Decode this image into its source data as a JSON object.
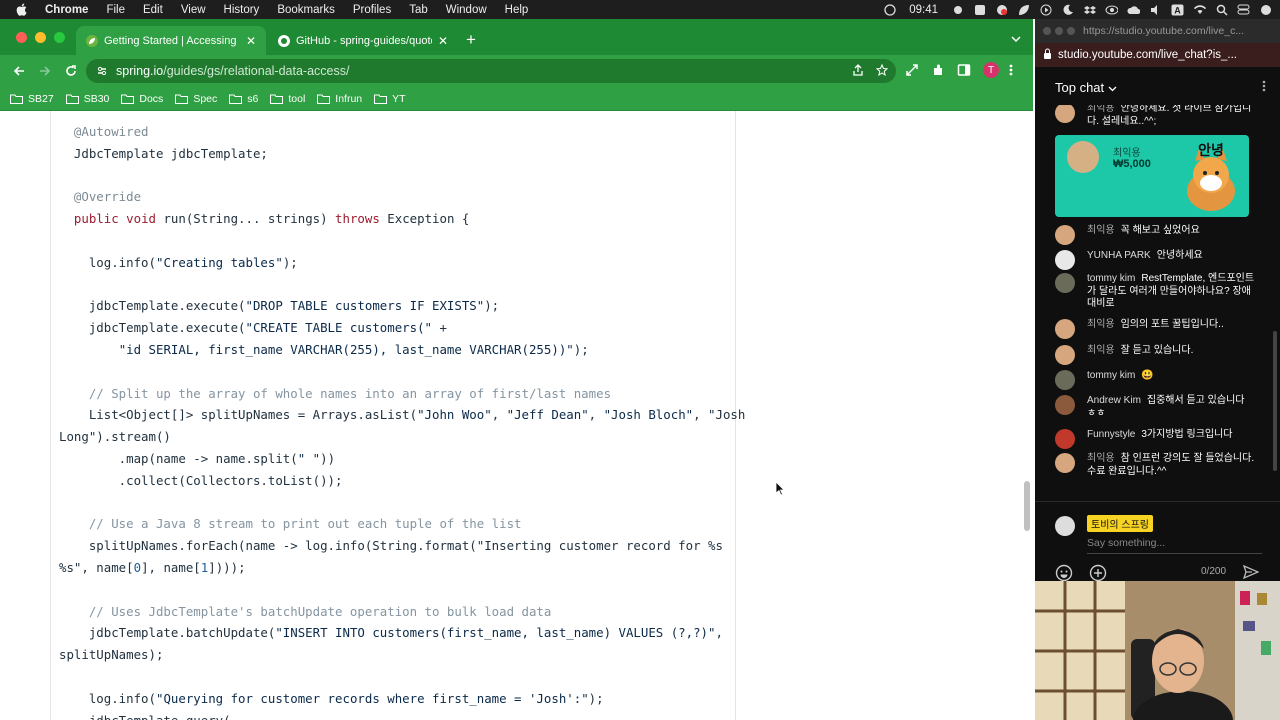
{
  "menubar": {
    "app": "Chrome",
    "items": [
      "File",
      "Edit",
      "View",
      "History",
      "Bookmarks",
      "Profiles",
      "Tab",
      "Window",
      "Help"
    ],
    "time": "09:41"
  },
  "browser": {
    "tabs": [
      {
        "title": "Getting Started | Accessing Re"
      },
      {
        "title": "GitHub - spring-guides/quoter"
      }
    ],
    "url_host": "spring.io",
    "url_path": "/guides/gs/relational-data-access/",
    "profile_initial": "T",
    "bookmarks": [
      "SB27",
      "SB30",
      "Docs",
      "Spec",
      "s6",
      "tool",
      "Infrun",
      "YT"
    ]
  },
  "code": [
    {
      "t": "ann",
      "s": "  @Autowired"
    },
    {
      "t": "plain",
      "s": "  JdbcTemplate jdbcTemplate;"
    },
    {
      "t": "plain",
      "s": ""
    },
    {
      "t": "ann",
      "s": "  @Override"
    },
    {
      "t": "mixed",
      "s": "  public void run(String... strings) throws Exception {"
    },
    {
      "t": "plain",
      "s": ""
    },
    {
      "t": "plain",
      "s": "    log.info(\"Creating tables\");"
    },
    {
      "t": "plain",
      "s": ""
    },
    {
      "t": "plain",
      "s": "    jdbcTemplate.execute(\"DROP TABLE customers IF EXISTS\");"
    },
    {
      "t": "plain",
      "s": "    jdbcTemplate.execute(\"CREATE TABLE customers(\" +"
    },
    {
      "t": "plain",
      "s": "        \"id SERIAL, first_name VARCHAR(255), last_name VARCHAR(255))\");"
    },
    {
      "t": "plain",
      "s": ""
    },
    {
      "t": "cm",
      "s": "    // Split up the array of whole names into an array of first/last names"
    },
    {
      "t": "plain",
      "s": "    List<Object[]> splitUpNames = Arrays.asList(\"John Woo\", \"Jeff Dean\", \"Josh Bloch\", \"Josh"
    },
    {
      "t": "plain",
      "s": "Long\").stream()"
    },
    {
      "t": "plain",
      "s": "        .map(name -> name.split(\" \"))"
    },
    {
      "t": "plain",
      "s": "        .collect(Collectors.toList());"
    },
    {
      "t": "plain",
      "s": ""
    },
    {
      "t": "cm",
      "s": "    // Use a Java 8 stream to print out each tuple of the list"
    },
    {
      "t": "plain",
      "s": "    splitUpNames.forEach(name -> log.info(String.format(\"Inserting customer record for %s"
    },
    {
      "t": "plain",
      "s": "%s\", name[0], name[1])));"
    },
    {
      "t": "plain",
      "s": ""
    },
    {
      "t": "cm",
      "s": "    // Uses JdbcTemplate's batchUpdate operation to bulk load data"
    },
    {
      "t": "plain",
      "s": "    jdbcTemplate.batchUpdate(\"INSERT INTO customers(first_name, last_name) VALUES (?,?)\","
    },
    {
      "t": "plain",
      "s": "splitUpNames);"
    },
    {
      "t": "plain",
      "s": ""
    },
    {
      "t": "plain",
      "s": "    log.info(\"Querying for customer records where first_name = 'Josh':\");"
    },
    {
      "t": "plain",
      "s": "    jdbcTemplate.query("
    }
  ],
  "chat": {
    "url_top": "https://studio.youtube.com/live_c...",
    "url": "studio.youtube.com/live_chat?is_...",
    "header": "Top chat",
    "first_msg": {
      "author": "최익용",
      "text": "안녕하세요. 첫 라이브 참가입니다. 설레네요..^^;"
    },
    "superchat": {
      "name": "최익용",
      "amount": "₩5,000",
      "sticker_text": "안녕"
    },
    "messages": [
      {
        "author": "최익용",
        "text": "꼭 해보고 싶었어요",
        "color": "#d6a67f"
      },
      {
        "author": "YUNHA PARK",
        "text": "안녕하세요",
        "color": "#e8e8e8"
      },
      {
        "author": "tommy kim",
        "text": "RestTemplate, 엔드포인트가 달라도 여러개 만들어야하나요? 장애 대비로",
        "color": "#6b6b5a"
      },
      {
        "author": "최익용",
        "text": "임의의 포트 꿀팁입니다..",
        "color": "#d6a67f"
      },
      {
        "author": "최익용",
        "text": "잘 듣고 있습니다.",
        "color": "#d6a67f"
      },
      {
        "author": "tommy kim",
        "text": "😃",
        "color": "#6b6b5a"
      },
      {
        "author": "Andrew Kim",
        "text": "집중해서 듣고 있습니다 ㅎㅎ",
        "color": "#8b5a3c"
      },
      {
        "author": "Funnystyle",
        "text": "3가지방법 링크입니다",
        "color": "#c0392b"
      },
      {
        "author": "최익용",
        "text": "참 인프런 강의도 잘 들었습니다. 수료 완료입니다.^^",
        "color": "#d6a67f"
      }
    ],
    "my_name": "토비의 스프링",
    "placeholder": "Say something...",
    "count": "0/200"
  },
  "colors": {
    "tabstrip": "#1e8a33",
    "toolbar": "#2fa043",
    "superchat": "#1dc8a8"
  }
}
